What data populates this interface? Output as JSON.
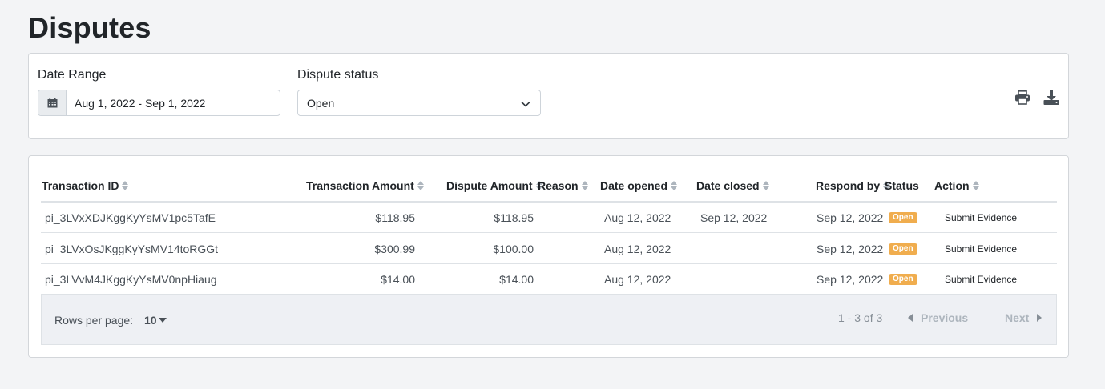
{
  "page": {
    "title": "Disputes"
  },
  "filters": {
    "date_range_label": "Date Range",
    "date_range_value": "Aug 1, 2022 - Sep 1, 2022",
    "status_label": "Dispute status",
    "status_value": "Open"
  },
  "toolbar": {
    "icons": [
      "printer-icon",
      "download-icon"
    ]
  },
  "table": {
    "columns": [
      "Transaction ID",
      "Transaction Amount",
      "Dispute Amount",
      "Reason",
      "Date opened",
      "Date closed",
      "Respond by",
      "Status",
      "Action"
    ],
    "rows": [
      {
        "transaction_id": "pi_3LVxXDJKggKyYsMV1pc5TafE",
        "transaction_amount": "$118.95",
        "dispute_amount": "$118.95",
        "reason": "",
        "date_opened": "Aug 12, 2022",
        "date_closed": "Sep 12, 2022",
        "respond_by": "Sep 12, 2022",
        "status": "Open",
        "action": "Submit Evidence"
      },
      {
        "transaction_id": "pi_3LVxOsJKggKyYsMV14toRGGt",
        "transaction_amount": "$300.99",
        "dispute_amount": "$100.00",
        "reason": "",
        "date_opened": "Aug 12, 2022",
        "date_closed": "",
        "respond_by": "Sep 12, 2022",
        "status": "Open",
        "action": "Submit Evidence"
      },
      {
        "transaction_id": "pi_3LVvM4JKggKyYsMV0npHiaug",
        "transaction_amount": "$14.00",
        "dispute_amount": "$14.00",
        "reason": "",
        "date_opened": "Aug 12, 2022",
        "date_closed": "",
        "respond_by": "Sep 12, 2022",
        "status": "Open",
        "action": "Submit Evidence"
      }
    ]
  },
  "pagination": {
    "rows_per_page_label": "Rows per page:",
    "rows_per_page_value": "10",
    "range_text": "1 - 3 of 3",
    "previous_label": "Previous",
    "next_label": "Next"
  },
  "colors": {
    "status_open": "#f0ad4e",
    "background": "#f3f4f6"
  }
}
